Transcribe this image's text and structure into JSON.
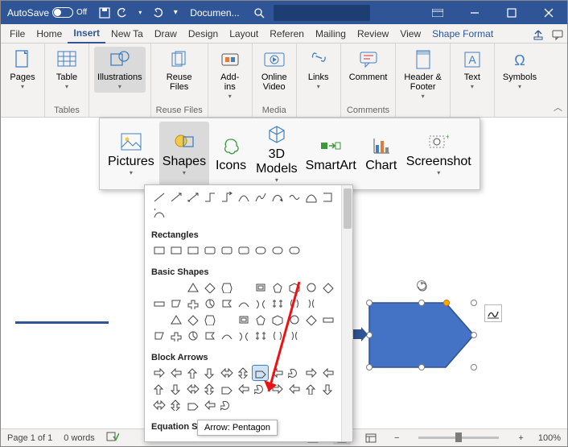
{
  "titlebar": {
    "autosave": "AutoSave",
    "autosave_state": "Off",
    "doc_title": "Documen..."
  },
  "tabs": {
    "items": [
      "File",
      "Home",
      "Insert",
      "New Ta",
      "Draw",
      "Design",
      "Layout",
      "Referen",
      "Mailing",
      "Review",
      "View",
      "Shape Format"
    ],
    "active_index": 2,
    "contextual_index": 11
  },
  "ribbon": {
    "pages": {
      "label": "Pages"
    },
    "tables_group": "Tables",
    "table": {
      "label": "Table"
    },
    "illustrations": {
      "label": "Illustrations"
    },
    "reuse_files": {
      "label": "Reuse\nFiles",
      "group": "Reuse Files"
    },
    "addins": {
      "label": "Add-\nins"
    },
    "online_video": {
      "label": "Online\nVideo",
      "group": "Media"
    },
    "links": {
      "label": "Links"
    },
    "comment": {
      "label": "Comment",
      "group": "Comments"
    },
    "header_footer": {
      "label": "Header &\nFooter"
    },
    "text": {
      "label": "Text"
    },
    "symbols": {
      "label": "Symbols"
    }
  },
  "illus_flyout": {
    "pictures": "Pictures",
    "shapes": "Shapes",
    "icons": "Icons",
    "models": "3D\nModels",
    "smartart": "SmartArt",
    "chart": "Chart",
    "screenshot": "Screenshot"
  },
  "gallery": {
    "rect_title": "Rectangles",
    "basic_title": "Basic Shapes",
    "block_title": "Block Arrows",
    "eqn_title": "Equation Shapes",
    "tooltip": "Arrow: Pentagon"
  },
  "status": {
    "page": "Page 1 of 1",
    "words": "0 words",
    "zoom": "100%"
  }
}
